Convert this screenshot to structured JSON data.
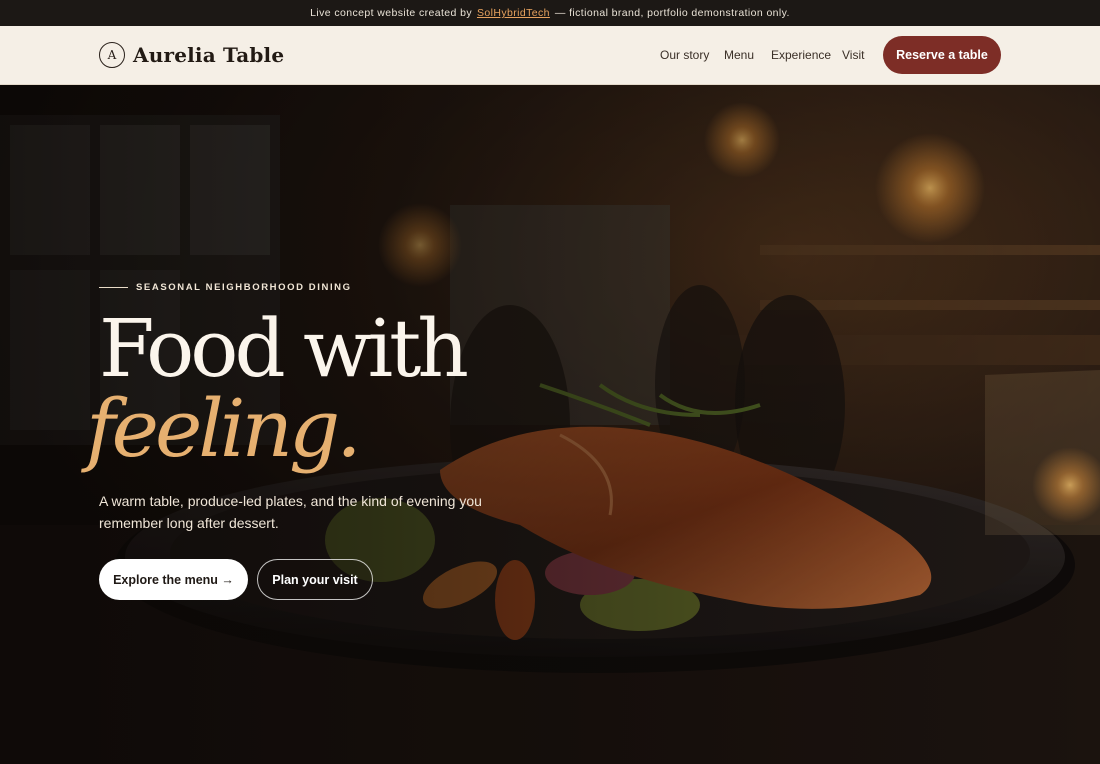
{
  "announcement": {
    "prefix": "Live concept website created by",
    "link": "SolHybridTech",
    "suffix": "— fictional brand, portfolio demonstration only."
  },
  "header": {
    "logo_letter": "A",
    "brand": "Aurelia Table",
    "nav": [
      "Our story",
      "Menu",
      "Experience",
      "Visit"
    ],
    "cta": "Reserve a table"
  },
  "hero": {
    "eyebrow": "SEASONAL NEIGHBORHOOD DINING",
    "headline": "Food with",
    "headline_accent": "feeling.",
    "subtitle": "A warm table, produce-led plates, and the kind of evening you remember long after dessert.",
    "primary_cta": "Explore the menu →",
    "secondary_cta": "Plan your visit"
  },
  "colors": {
    "accent": "#7d2d26",
    "headline_accent": "#e6b070",
    "announcement_bg": "#1c1815",
    "header_bg": "#f5efe6"
  }
}
